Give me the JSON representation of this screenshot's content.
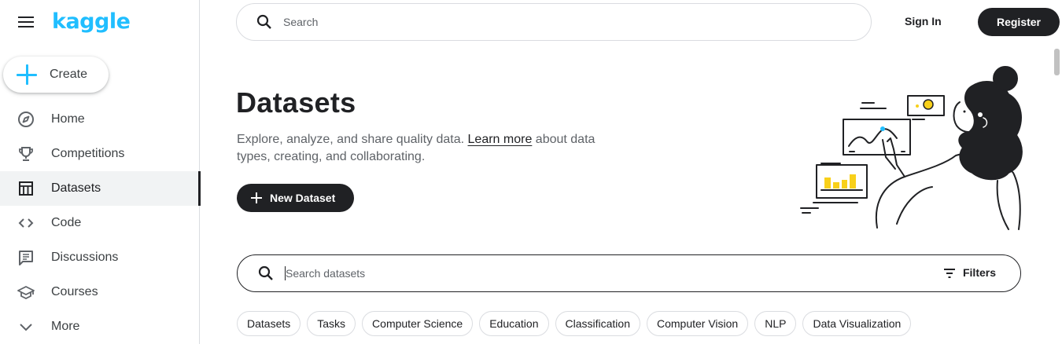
{
  "sidebar": {
    "logo": "kaggle",
    "create_label": "Create",
    "items": [
      {
        "label": "Home",
        "icon": "compass-icon"
      },
      {
        "label": "Competitions",
        "icon": "trophy-icon"
      },
      {
        "label": "Datasets",
        "icon": "table-icon",
        "active": true
      },
      {
        "label": "Code",
        "icon": "code-icon"
      },
      {
        "label": "Discussions",
        "icon": "comments-icon"
      },
      {
        "label": "Courses",
        "icon": "school-icon"
      },
      {
        "label": "More",
        "icon": "chevron-down-icon"
      }
    ]
  },
  "header": {
    "search_placeholder": "Search",
    "signin_label": "Sign In",
    "register_label": "Register"
  },
  "main": {
    "title": "Datasets",
    "description_pre": "Explore, analyze, and share quality data. ",
    "learn_more": "Learn more",
    "description_post": " about data types, creating, and collaborating.",
    "new_dataset_label": "New Dataset",
    "dataset_search_placeholder": "Search datasets",
    "filters_label": "Filters",
    "chips": [
      "Datasets",
      "Tasks",
      "Computer Science",
      "Education",
      "Classification",
      "Computer Vision",
      "NLP",
      "Data Visualization"
    ]
  },
  "colors": {
    "brand": "#20beff",
    "dark": "#202124",
    "accent_yellow": "#f8d01a"
  }
}
